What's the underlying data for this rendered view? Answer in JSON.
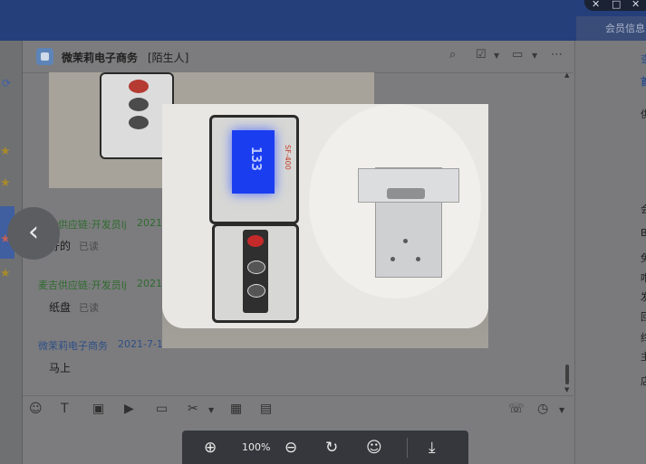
{
  "chat": {
    "contact_name": "微茉莉电子商务",
    "contact_tag": "[陌生人]",
    "messages": [
      {
        "sender": "麦吉供应链:开发员lj",
        "time": "2021",
        "text": "好的",
        "status": "已读"
      },
      {
        "sender": "麦吉供应链:开发员lj",
        "time": "2021",
        "text": "纸盘",
        "status": "已读"
      },
      {
        "sender": "微茉莉电子商务",
        "time": "2021-7-1",
        "text": "马上"
      }
    ]
  },
  "right_panel": {
    "tab": "会员信息",
    "lines": [
      "查",
      "首",
      "供",
      "会",
      "B",
      "兔",
      "咁",
      "发",
      "回",
      "终",
      "主",
      "店"
    ]
  },
  "image_viewer": {
    "scale_display": "133",
    "scale_model": "SF-400",
    "zoom_level": "100%"
  },
  "colors": {
    "topbar": "#243f7a",
    "lcd": "#1a3df0"
  },
  "icons": [
    "search-user-icon",
    "edit-icon",
    "video-icon",
    "more-icon",
    "emoji-icon",
    "text-format-icon",
    "screenshot-icon",
    "play-icon",
    "folder-icon",
    "scissors-icon",
    "calculator-icon",
    "document-icon",
    "chat-icon",
    "history-icon",
    "zoom-in-icon",
    "zoom-out-icon",
    "rotate-icon",
    "smile-icon",
    "download-icon",
    "back-arrow-icon"
  ]
}
